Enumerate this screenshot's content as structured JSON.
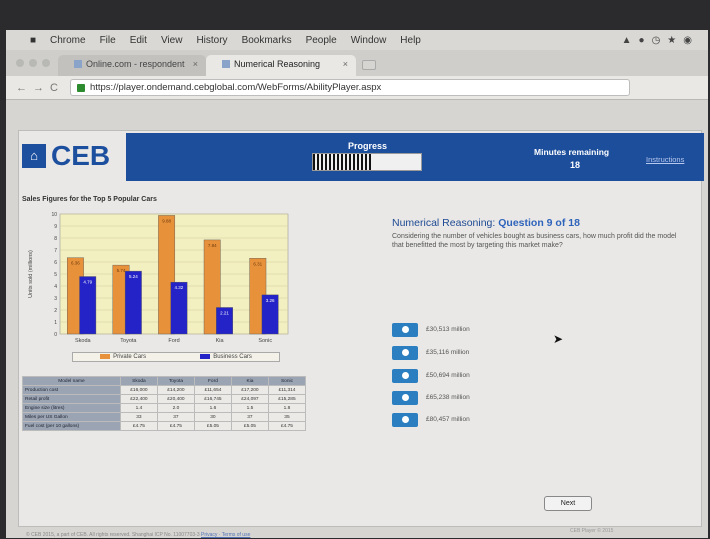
{
  "menubar": {
    "app": "Chrome",
    "items": [
      "File",
      "Edit",
      "View",
      "History",
      "Bookmarks",
      "People",
      "Window",
      "Help"
    ]
  },
  "tabs": [
    {
      "label": "Online.com - respondent",
      "active": false
    },
    {
      "label": "Numerical Reasoning",
      "active": true
    }
  ],
  "address": {
    "url": "https://player.ondemand.cebglobal.com/WebForms/AbilityPlayer.aspx"
  },
  "brand": {
    "logo_text": "CEB"
  },
  "banner": {
    "progress_label": "Progress",
    "progress_fraction": 0.55,
    "minutes_label": "Minutes remaining",
    "minutes_value": "18",
    "instructions_link": "Instructions"
  },
  "chart_data": {
    "type": "bar",
    "title": "Sales Figures for the Top 5 Popular Cars",
    "ylabel": "Units sold (millions)",
    "xlabel": "",
    "categories": [
      "Skoda",
      "Toyota",
      "Ford",
      "Kia",
      "Sonic"
    ],
    "ylim": [
      0,
      10
    ],
    "grid": true,
    "legend_position": "bottom",
    "series": [
      {
        "name": "Private Cars",
        "color": "#e8913b",
        "values": [
          6.36,
          5.74,
          9.88,
          7.84,
          6.31
        ]
      },
      {
        "name": "Business Cars",
        "color": "#2323c8",
        "values": [
          4.79,
          5.24,
          4.32,
          2.21,
          3.26
        ]
      }
    ]
  },
  "data_table": {
    "headers": [
      "Model name",
      "Skoda",
      "Toyota",
      "Ford",
      "Kia",
      "Sonic"
    ],
    "rows": [
      {
        "label": "Production cost",
        "cells": [
          "£16,000",
          "£14,200",
          "£11,654",
          "£17,200",
          "£11,314"
        ]
      },
      {
        "label": "Retail profit",
        "cells": [
          "£22,400",
          "£20,400",
          "£16,745",
          "£24,097",
          "£15,285"
        ]
      },
      {
        "label": "Engine size (litres)",
        "cells": [
          "1.4",
          "2.0",
          "1.6",
          "1.5",
          "1.8"
        ]
      },
      {
        "label": "Miles per US Gallon",
        "cells": [
          "33",
          "37",
          "30",
          "37",
          "35"
        ]
      },
      {
        "label": "Fuel cost (per 10 gallons)",
        "cells": [
          "£4.75",
          "£4.75",
          "£5.05",
          "£5.05",
          "£4.75"
        ]
      }
    ]
  },
  "question": {
    "title": "Numerical Reasoning:",
    "number": "Question 9 of 18",
    "text": "Considering the number of vehicles bought as business cars, how much profit did the model that benefitted the most by targeting this market make?",
    "options": [
      "£30,513 million",
      "£35,116 million",
      "£50,694 million",
      "£65,238 million",
      "£80,457 million"
    ]
  },
  "next_label": "Next",
  "footer": {
    "copyright": "© CEB 2015, a part of CEB. All rights reserved. Shanghai ICP No. 11007703-3",
    "links": "Privacy · Terms of use",
    "right": "CEB Player © 2015"
  }
}
